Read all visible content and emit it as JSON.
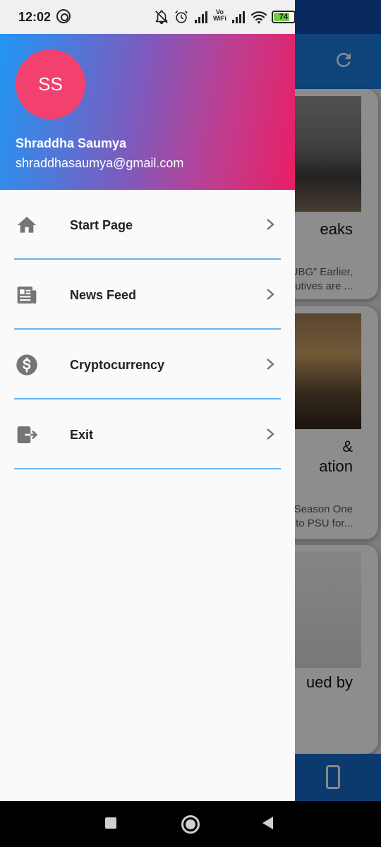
{
  "status_bar": {
    "time": "12:02",
    "vowifi_top": "Vo",
    "vowifi_bottom": "WiFi",
    "battery_level": "74"
  },
  "background": {
    "cards": [
      {
        "title": "eaks",
        "snippet_1": "UBG” Earlier,",
        "snippet_2": "utives are ..."
      },
      {
        "title_1": "&",
        "title_2": "ation",
        "snippet_1": "Season One",
        "snippet_2": "e to PSU for..."
      },
      {
        "title": "ued by"
      }
    ]
  },
  "drawer": {
    "header": {
      "avatar_initials": "SS",
      "user_name": "Shraddha Saumya",
      "user_email": "shraddhasaumya@gmail.com"
    },
    "menu": [
      {
        "label": "Start Page",
        "icon": "home-icon"
      },
      {
        "label": "News Feed",
        "icon": "newspaper-icon"
      },
      {
        "label": "Cryptocurrency",
        "icon": "dollar-circle-icon"
      },
      {
        "label": "Exit",
        "icon": "exit-icon"
      }
    ]
  },
  "colors": {
    "header_gradient_start": "#2196f3",
    "header_gradient_end": "#e91e63",
    "avatar": "#f2416f",
    "divider": "#64b5f6",
    "icon_gray": "#757575"
  }
}
